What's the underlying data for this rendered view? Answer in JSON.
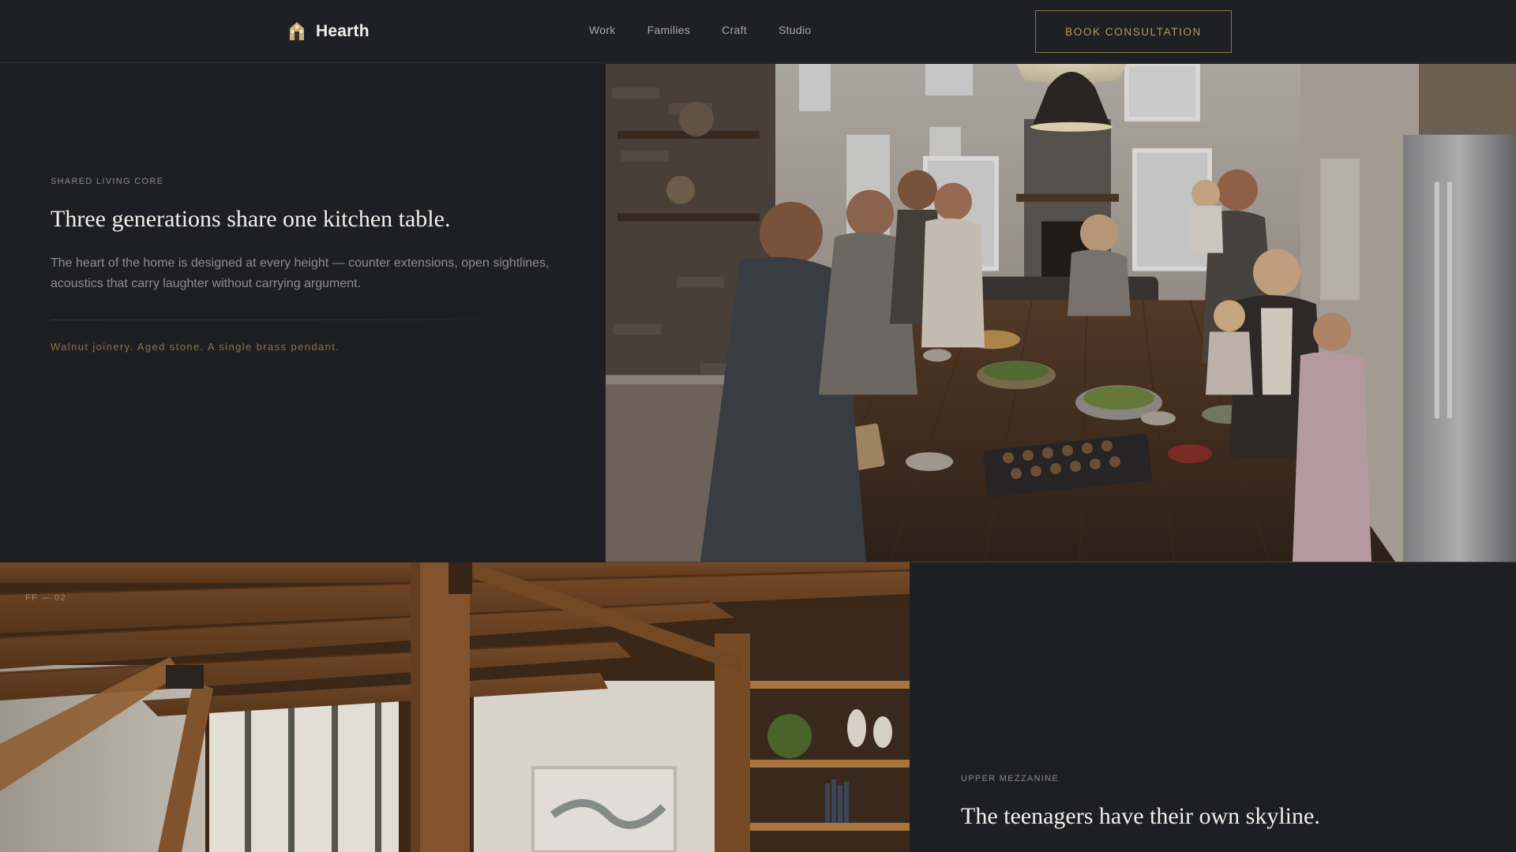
{
  "brand": {
    "name": "Hearth",
    "icon": "house-icon"
  },
  "nav": {
    "items": [
      "Work",
      "Families",
      "Craft",
      "Studio"
    ]
  },
  "cta": {
    "label": "BOOK CONSULTATION"
  },
  "section1": {
    "eyebrow": "SHARED LIVING CORE",
    "heading": "Three generations share one kitchen table.",
    "body": "The heart of the home is designed at every height — counter extensions, open sightlines, acoustics that carry laughter without carrying argument.",
    "accent": "Walnut joinery. Aged stone. A single brass pendant."
  },
  "section2": {
    "floor_code": "FF — 02",
    "eyebrow": "UPPER MEZZANINE",
    "heading": "The teenagers have their own skyline."
  },
  "colors": {
    "background": "#1e1f23",
    "accent_gold": "#b89a5f",
    "cta_border": "#8d7447",
    "heading_text": "#f1efe9",
    "muted_text": "#8e8d89"
  }
}
